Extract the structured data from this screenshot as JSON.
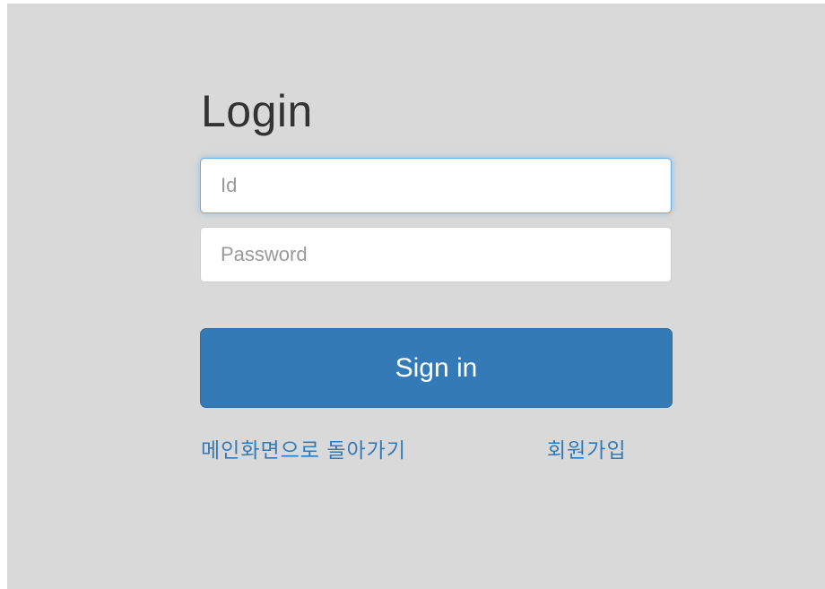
{
  "login": {
    "title": "Login",
    "id_placeholder": "Id",
    "password_placeholder": "Password",
    "signin_label": "Sign in",
    "back_to_main_label": "메인화면으로 돌아가기",
    "signup_label": "회원가입"
  },
  "colors": {
    "panel_background": "#d9d9d9",
    "primary": "#337ab7",
    "focus_border": "#66afe9",
    "title_text": "#333333"
  }
}
